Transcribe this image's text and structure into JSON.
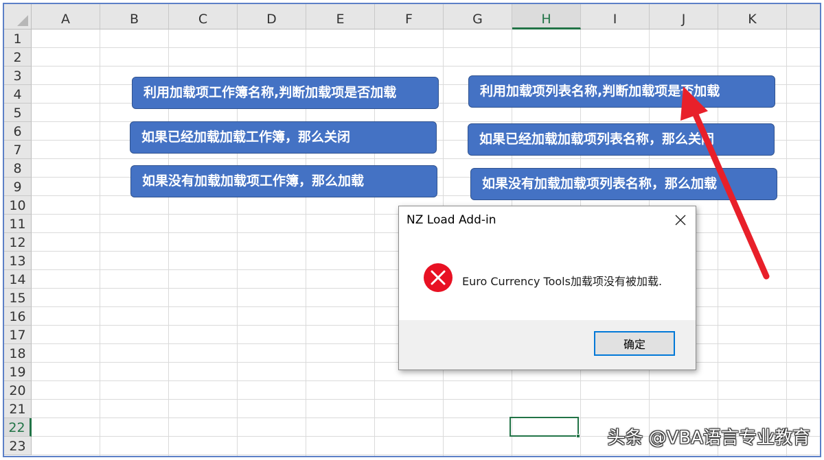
{
  "sheet": {
    "columns": [
      "A",
      "B",
      "C",
      "D",
      "E",
      "F",
      "G",
      "H",
      "I",
      "J",
      "K"
    ],
    "active_column": "H",
    "rows": [
      "1",
      "2",
      "3",
      "4",
      "5",
      "6",
      "7",
      "8",
      "9",
      "10",
      "11",
      "12",
      "13",
      "14",
      "15",
      "16",
      "17",
      "18",
      "19",
      "20",
      "21",
      "22",
      "23"
    ],
    "active_row": "22",
    "accent_color": "#217346"
  },
  "buttons": {
    "left": [
      "利用加载项工作簿名称,判断加载项是否加载",
      "如果已经加载加载工作簿，那么关闭",
      "如果没有加载加载项工作簿，那么加载"
    ],
    "right": [
      "利用加载项列表名称,判断加载项是否加载",
      "如果已经加载加载项列表名称，那么关闭",
      "如果没有加载加载项列表名称，那么加载"
    ],
    "fill_color": "#4472c4"
  },
  "dialog": {
    "title": "NZ Load Add-in",
    "message": "Euro Currency Tools加载项没有被加载.",
    "ok_label": "确定",
    "icon": "error-icon",
    "close_icon": "close-icon",
    "icon_color": "#e81123"
  },
  "annotation": {
    "arrow_color": "#e8202a"
  },
  "watermark": {
    "text": "头条 @VBA语言专业教育"
  }
}
